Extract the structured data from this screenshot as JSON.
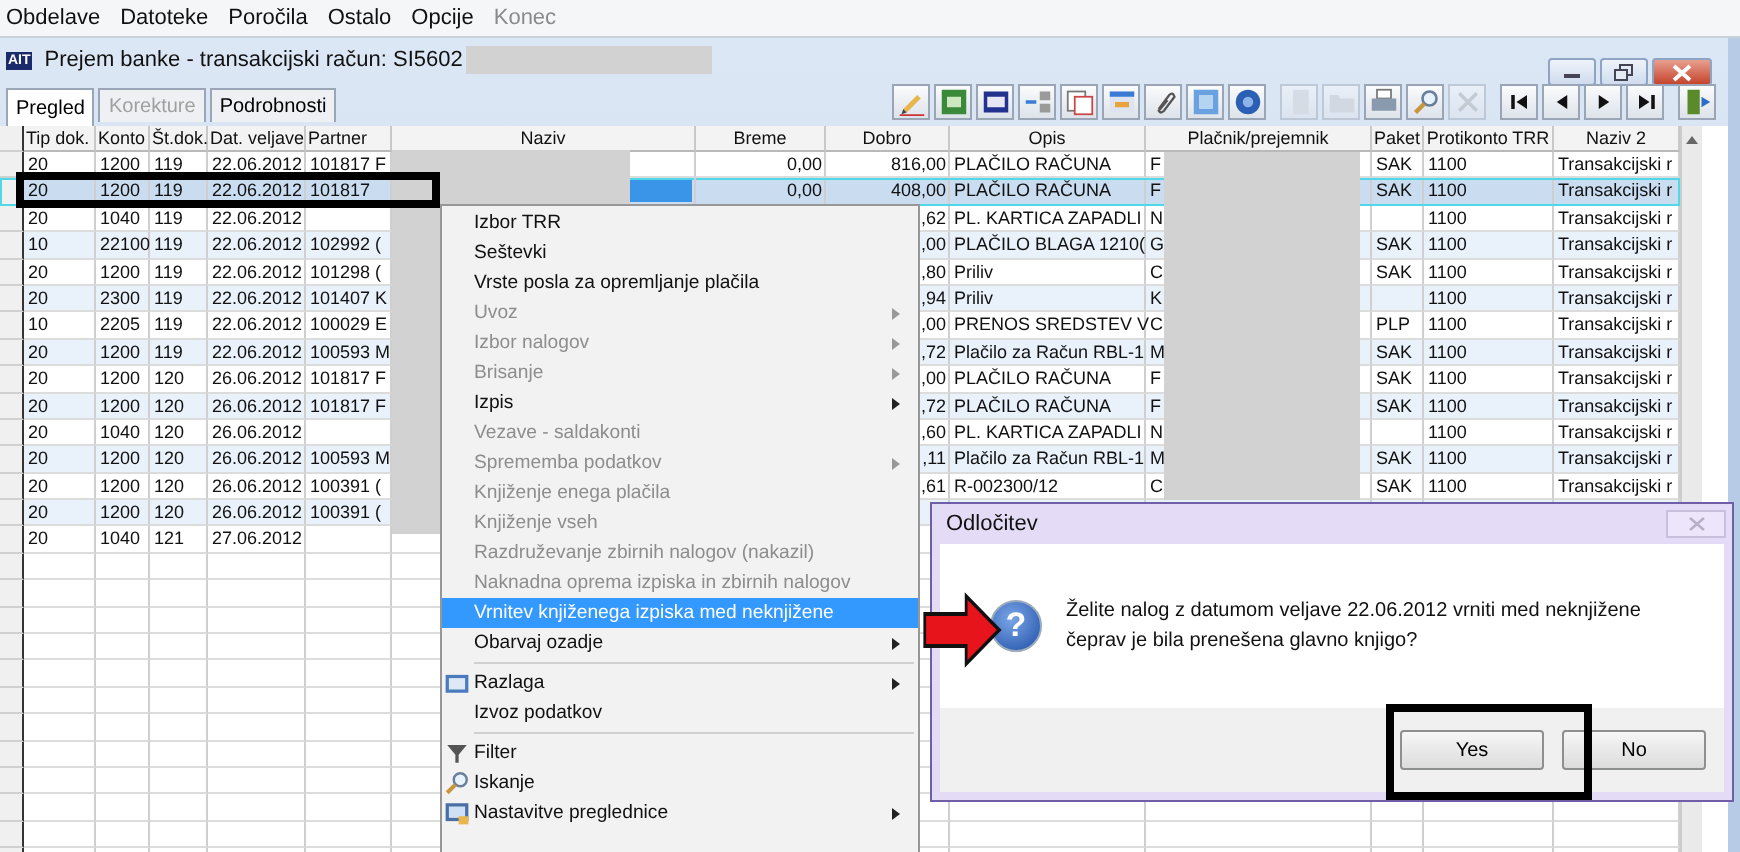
{
  "menu_bar": [
    {
      "label": "Obdelave",
      "disabled": false
    },
    {
      "label": "Datoteke",
      "disabled": false
    },
    {
      "label": "Poročila",
      "disabled": false
    },
    {
      "label": "Ostalo",
      "disabled": false
    },
    {
      "label": "Opcije",
      "disabled": false
    },
    {
      "label": "Konec",
      "disabled": true
    }
  ],
  "window": {
    "logo": "AIT",
    "title": "Prejem banke - transakcijski račun: SI5602"
  },
  "tabs": [
    {
      "label": "Pregled",
      "selected": true,
      "disabled": false
    },
    {
      "label": "Korekture",
      "selected": false,
      "disabled": true
    },
    {
      "label": "Podrobnosti",
      "selected": false,
      "disabled": false
    }
  ],
  "toolbar": [
    {
      "disabled": false
    },
    {
      "disabled": false
    },
    {
      "disabled": false
    },
    {
      "disabled": false
    },
    {
      "disabled": false
    },
    {
      "disabled": false
    },
    {
      "disabled": false
    },
    {
      "disabled": false
    },
    {
      "disabled": false
    },
    {
      "disabled": true
    },
    {
      "disabled": true
    },
    {
      "disabled": false
    },
    {
      "disabled": false
    },
    {
      "disabled": true
    },
    {
      "disabled": false
    },
    {
      "disabled": false
    },
    {
      "disabled": false
    },
    {
      "disabled": false
    },
    {
      "disabled": false
    }
  ],
  "table": {
    "columns": [
      "Tip dok.",
      "Konto",
      "Št.dok.",
      "Dat. veljave",
      "Partner",
      "Naziv",
      "Breme",
      "Dobro",
      "Opis",
      "Plačnik/prejemnik",
      "Paket",
      "Protikonto TRR",
      "Naziv 2"
    ],
    "rows": [
      {
        "selected": false,
        "tip": "20",
        "konto": "1200",
        "st": "119",
        "datum": "22.06.2012",
        "partner": "101817 F",
        "breme": "0,00",
        "dobro": "816,00",
        "opis": "PLAČILO RAČUNA",
        "placnik": "F",
        "paket": "SAK",
        "protikonto": "1100",
        "naziv_2": "Transakcijski r"
      },
      {
        "selected": true,
        "tip": "20",
        "konto": "1200",
        "st": "119",
        "datum": "22.06.2012",
        "partner": "101817",
        "breme": "0,00",
        "dobro": "408,00",
        "opis": "PLAČILO RAČUNA",
        "placnik": "F",
        "paket": "SAK",
        "protikonto": "1100",
        "naziv_2": "Transakcijski r"
      },
      {
        "selected": false,
        "tip": "20",
        "konto": "1040",
        "st": "119",
        "datum": "22.06.2012",
        "dobro": ",62",
        "opis": "PL. KARTICA ZAPADLI",
        "placnik": "N",
        "protikonto": "1100",
        "naziv_2": "Transakcijski r"
      },
      {
        "selected": false,
        "tip": "10",
        "konto": "22100",
        "st": "119",
        "datum": "22.06.2012",
        "partner": "102992 (",
        "dobro": ",00",
        "opis": "PLAČILO BLAGA 1210(",
        "placnik": "G",
        "paket": "SAK",
        "protikonto": "1100",
        "naziv_2": "Transakcijski r"
      },
      {
        "selected": false,
        "tip": "20",
        "konto": "1200",
        "st": "119",
        "datum": "22.06.2012",
        "partner": "101298 (",
        "dobro": ",80",
        "opis": "Priliv",
        "placnik": "C",
        "paket": "SAK",
        "protikonto": "1100",
        "naziv_2": "Transakcijski r"
      },
      {
        "selected": false,
        "tip": "20",
        "konto": "2300",
        "st": "119",
        "datum": "22.06.2012",
        "partner": "101407 K",
        "dobro": ",94",
        "opis": "Priliv",
        "placnik": "K",
        "protikonto": "1100",
        "naziv_2": "Transakcijski r"
      },
      {
        "selected": false,
        "tip": "10",
        "konto": "2205",
        "st": "119",
        "datum": "22.06.2012",
        "partner": "100029 E",
        "dobro": ",00",
        "opis": "PRENOS SREDSTEV V",
        "placnik": "C",
        "paket": "PLP",
        "protikonto": "1100",
        "naziv_2": "Transakcijski r"
      },
      {
        "selected": false,
        "tip": "20",
        "konto": "1200",
        "st": "119",
        "datum": "22.06.2012",
        "partner": "100593 M",
        "dobro": ",72",
        "opis": "Plačilo za Račun RBL-1",
        "placnik": "M",
        "paket": "SAK",
        "protikonto": "1100",
        "naziv_2": "Transakcijski r"
      },
      {
        "selected": false,
        "tip": "20",
        "konto": "1200",
        "st": "120",
        "datum": "26.06.2012",
        "partner": "101817 F",
        "dobro": ",00",
        "opis": "PLAČILO RAČUNA",
        "placnik": "F",
        "paket": "SAK",
        "protikonto": "1100",
        "naziv_2": "Transakcijski r"
      },
      {
        "selected": false,
        "tip": "20",
        "konto": "1200",
        "st": "120",
        "datum": "26.06.2012",
        "partner": "101817 F",
        "dobro": ",72",
        "opis": "PLAČILO RAČUNA",
        "placnik": "F",
        "paket": "SAK",
        "protikonto": "1100",
        "naziv_2": "Transakcijski r"
      },
      {
        "selected": false,
        "tip": "20",
        "konto": "1040",
        "st": "120",
        "datum": "26.06.2012",
        "dobro": ",60",
        "opis": "PL. KARTICA ZAPADLI",
        "placnik": "N",
        "protikonto": "1100",
        "naziv_2": "Transakcijski r"
      },
      {
        "selected": false,
        "tip": "20",
        "konto": "1200",
        "st": "120",
        "datum": "26.06.2012",
        "partner": "100593 M",
        "dobro": ",11",
        "opis": "Plačilo za Račun RBL-1",
        "placnik": "M",
        "paket": "SAK",
        "protikonto": "1100",
        "naziv_2": "Transakcijski r"
      },
      {
        "selected": false,
        "tip": "20",
        "konto": "1200",
        "st": "120",
        "datum": "26.06.2012",
        "partner": "100391 (",
        "dobro": ",61",
        "opis": "R-002300/12",
        "placnik": "C",
        "paket": "SAK",
        "protikonto": "1100",
        "naziv_2": "Transakcijski r"
      },
      {
        "selected": false,
        "tip": "20",
        "konto": "1200",
        "st": "120",
        "datum": "26.06.2012",
        "partner": "100391 ("
      },
      {
        "selected": false,
        "tip": "20",
        "konto": "1040",
        "st": "121",
        "datum": "27.06.2012"
      }
    ]
  },
  "context_menu": {
    "groups": [
      [
        {
          "label": "Izbor TRR",
          "disabled": false,
          "submenu": false,
          "selected": false,
          "has_icon": false
        },
        {
          "label": "Seštevki",
          "disabled": false,
          "submenu": false,
          "selected": false,
          "has_icon": false
        },
        {
          "label": "Vrste posla za opremljanje plačila",
          "disabled": false,
          "submenu": false,
          "selected": false,
          "has_icon": false
        },
        {
          "label": "Uvoz",
          "disabled": true,
          "submenu": true,
          "selected": false,
          "has_icon": false
        },
        {
          "label": "Izbor nalogov",
          "disabled": true,
          "submenu": true,
          "selected": false,
          "has_icon": false
        },
        {
          "label": "Brisanje",
          "disabled": true,
          "submenu": true,
          "selected": false,
          "has_icon": false
        },
        {
          "label": "Izpis",
          "disabled": false,
          "submenu": true,
          "selected": false,
          "has_icon": false
        },
        {
          "label": "Vezave - saldakonti",
          "disabled": true,
          "submenu": false,
          "selected": false,
          "has_icon": false
        },
        {
          "label": "Sprememba podatkov",
          "disabled": true,
          "submenu": true,
          "selected": false,
          "has_icon": false
        },
        {
          "label": "Knjiženje enega plačila",
          "disabled": true,
          "submenu": false,
          "selected": false,
          "has_icon": false
        },
        {
          "label": "Knjiženje vseh",
          "disabled": true,
          "submenu": false,
          "selected": false,
          "has_icon": false
        },
        {
          "label": "Razdruževanje zbirnih nalogov (nakazil)",
          "disabled": true,
          "submenu": false,
          "selected": false,
          "has_icon": false
        },
        {
          "label": "Naknadna oprema izpiska in zbirnih nalogov",
          "disabled": true,
          "submenu": false,
          "selected": false,
          "has_icon": false
        },
        {
          "label": "Vrnitev knjiženega izpiska med neknjižene",
          "disabled": false,
          "submenu": false,
          "selected": true,
          "has_icon": false
        },
        {
          "label": "Obarvaj ozadje",
          "disabled": false,
          "submenu": true,
          "selected": false,
          "has_icon": false
        }
      ],
      [
        {
          "label": "Razlaga",
          "disabled": false,
          "submenu": true,
          "selected": false,
          "has_icon": true
        },
        {
          "label": "Izvoz podatkov",
          "disabled": false,
          "submenu": false,
          "selected": false,
          "has_icon": false
        }
      ],
      [
        {
          "label": "Filter",
          "disabled": false,
          "submenu": false,
          "selected": false,
          "has_icon": true
        },
        {
          "label": "Iskanje",
          "disabled": false,
          "submenu": false,
          "selected": false,
          "has_icon": true
        },
        {
          "label": "Nastavitve preglednice",
          "disabled": false,
          "submenu": true,
          "selected": false,
          "has_icon": true
        }
      ]
    ]
  },
  "dialog": {
    "title": "Odločitev",
    "icon_glyph": "?",
    "message": "Želite nalog z datumom veljave 22.06.2012 vrniti med neknjižene čeprav je bila prenešena glavno knjigo?",
    "buttons": [
      "Yes",
      "No"
    ]
  }
}
